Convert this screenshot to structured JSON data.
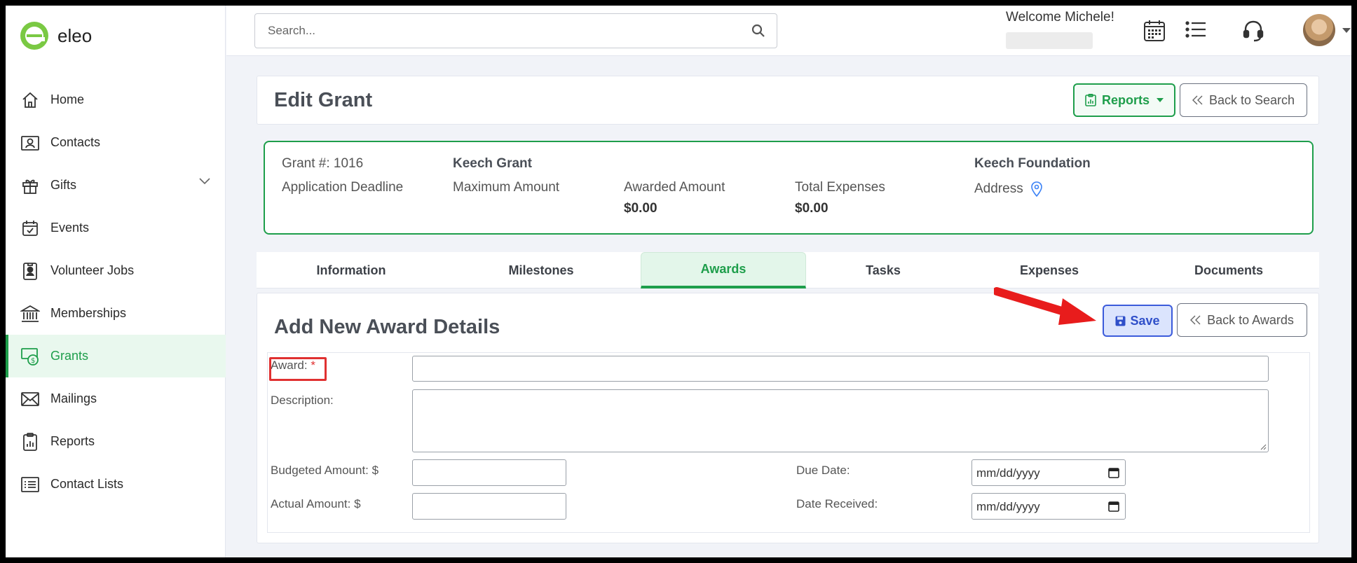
{
  "app": {
    "name": "eleo"
  },
  "sidebar": {
    "items": [
      {
        "label": "Home",
        "icon": "home-icon"
      },
      {
        "label": "Contacts",
        "icon": "contact-card-icon"
      },
      {
        "label": "Gifts",
        "icon": "gift-icon"
      },
      {
        "label": "Events",
        "icon": "calendar-check-icon"
      },
      {
        "label": "Volunteer Jobs",
        "icon": "badge-icon"
      },
      {
        "label": "Memberships",
        "icon": "bank-icon"
      },
      {
        "label": "Grants",
        "icon": "grant-money-icon"
      },
      {
        "label": "Mailings",
        "icon": "envelope-icon"
      },
      {
        "label": "Reports",
        "icon": "clipboard-chart-icon"
      },
      {
        "label": "Contact Lists",
        "icon": "list-icon"
      }
    ],
    "active": "Grants"
  },
  "topbar": {
    "search_placeholder": "Search...",
    "welcome": "Welcome Michele!"
  },
  "header": {
    "title": "Edit Grant",
    "reports_label": "Reports",
    "back_label": "Back to Search"
  },
  "grant": {
    "number_label": "Grant #: 1016",
    "name": "Keech Grant",
    "foundation": "Keech Foundation",
    "deadline_label": "Application Deadline",
    "max_label": "Maximum Amount",
    "awarded_label": "Awarded Amount",
    "awarded_value": "$0.00",
    "expenses_label": "Total Expenses",
    "expenses_value": "$0.00",
    "address_label": "Address"
  },
  "tabs": [
    "Information",
    "Milestones",
    "Awards",
    "Tasks",
    "Expenses",
    "Documents"
  ],
  "active_tab": "Awards",
  "form": {
    "title": "Add New Award Details",
    "save_label": "Save",
    "back_label": "Back to Awards",
    "award_label": "Award:",
    "award_required": "*",
    "description_label": "Description:",
    "budgeted_label": "Budgeted Amount: $",
    "actual_label": "Actual Amount: $",
    "due_label": "Due Date:",
    "received_label": "Date Received:",
    "date_placeholder": "mm/dd/yyyy",
    "award_value": "",
    "description_value": "",
    "budgeted_value": "",
    "actual_value": ""
  },
  "colors": {
    "brand_green": "#1e9e4b",
    "save_blue": "#3b5bdb",
    "annotation_red": "#e03131"
  }
}
